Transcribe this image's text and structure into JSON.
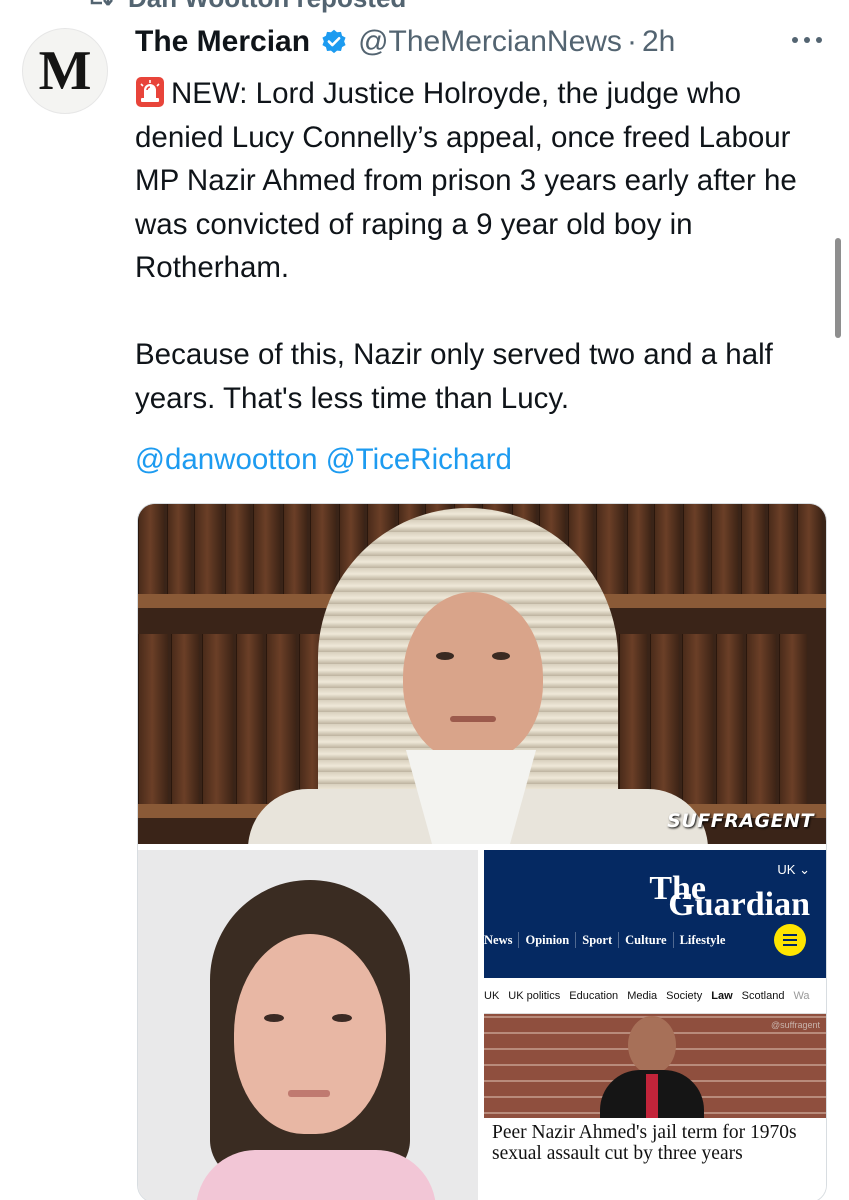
{
  "repost": {
    "label": "Dan Wootton reposted",
    "icon": "repost-icon"
  },
  "tweet": {
    "avatar_letter": "M",
    "display_name": "The Mercian",
    "verified_icon": "verified-badge-icon",
    "handle": "@TheMercianNews",
    "separator": "·",
    "time": "2h",
    "more_icon": "more-options-icon",
    "paragraph_1": "NEW: Lord Justice Holroyde, the judge who denied Lucy Connelly’s appeal, once freed Labour MP Nazir Ahmed from prison 3 years early after he was convicted of raping a 9 year old boy in Rotherham.",
    "paragraph_2": "Because of this, Nazir only served two and a half years. That's less time than Lucy.",
    "siren_icon": "police-siren-icon",
    "mentions": [
      "@danwootton",
      "@TiceRichard"
    ],
    "colors": {
      "link": "#1d9bf0",
      "muted": "#536471",
      "text": "#0f1419",
      "guardian_blue": "#052962",
      "guardian_yellow": "#ffe500"
    }
  },
  "media": {
    "judge_photo_watermark": "SUFFRAGENT",
    "guardian": {
      "edition": "UK",
      "logo_line_1": "The",
      "logo_line_2": "Guardian",
      "nav": [
        "News",
        "Opinion",
        "Sport",
        "Culture",
        "Lifestyle"
      ],
      "subnav": [
        "UK",
        "UK politics",
        "Education",
        "Media",
        "Society",
        "Law",
        "Scotland",
        "Wa"
      ],
      "photo_credit": "@suffragent",
      "headline": "Peer Nazir Ahmed's jail term for 1970s sexual assault cut by three years"
    }
  }
}
